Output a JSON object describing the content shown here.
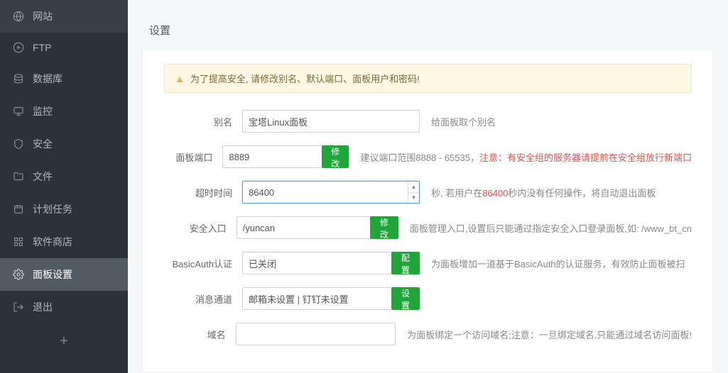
{
  "sidebar": {
    "items": [
      {
        "label": "网站",
        "icon": "globe"
      },
      {
        "label": "FTP",
        "icon": "ftp"
      },
      {
        "label": "数据库",
        "icon": "database"
      },
      {
        "label": "监控",
        "icon": "monitor"
      },
      {
        "label": "安全",
        "icon": "shield"
      },
      {
        "label": "文件",
        "icon": "folder"
      },
      {
        "label": "计划任务",
        "icon": "calendar"
      },
      {
        "label": "软件商店",
        "icon": "apps"
      },
      {
        "label": "面板设置",
        "icon": "settings",
        "active": true
      },
      {
        "label": "退出",
        "icon": "logout"
      }
    ]
  },
  "section_title": "设置",
  "alert_text": "为了提高安全, 请修改别名、默认端口、面板用户和密码!",
  "form": {
    "alias": {
      "label": "别名",
      "value": "宝塔Linux面板",
      "hint": "给面板取个别名"
    },
    "port": {
      "label": "面板端口",
      "value": "8889",
      "btn": "修改",
      "hint_a": "建议端口范围8888 - 65535，",
      "hint_red": "注意：有安全组的服务器请提前在安全组放行新端口"
    },
    "timeout": {
      "label": "超时时间",
      "value": "86400",
      "hint_a": "秒, 若用户在",
      "hint_red": "86400",
      "hint_b": "秒内没有任何操作，将自动退出面板"
    },
    "entry": {
      "label": "安全入口",
      "value": "/yuncan",
      "btn": "修改",
      "hint": "面板管理入口,设置后只能通过指定安全入口登录面板,如: /www_bt_cn"
    },
    "basic": {
      "label": "BasicAuth认证",
      "value": "已关闭",
      "btn": "配置",
      "hint": "为面板增加一道基于BasicAuth的认证服务，有效防止面板被扫"
    },
    "msg": {
      "label": "消息通道",
      "value": "邮箱未设置 | 钉钉未设置",
      "btn": "设置"
    },
    "domain": {
      "label": "域名",
      "value": "",
      "hint": "为面板绑定一个访问域名;注意：一旦绑定域名,只能通过域名访问面板!"
    }
  }
}
